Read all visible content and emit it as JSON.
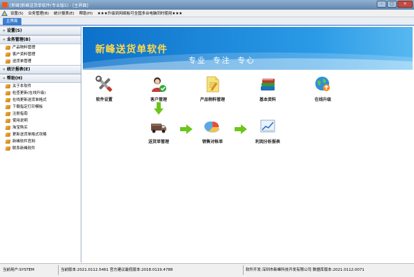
{
  "window": {
    "title": "[新峰]新峰送货单软件(专业版5) - [主界面]",
    "btn_min": "–",
    "btn_max": "□",
    "btn_close": "×"
  },
  "menubar": {
    "items": [
      "设置(S)",
      "业务管理(B)",
      "统计报表(E)",
      "帮助(H)",
      "★★★升级到网络板可全国多台电脑同时使用★★★"
    ]
  },
  "tab": {
    "label": "主界面"
  },
  "sidebar": {
    "sections": [
      {
        "title": "设置(S)",
        "chev": "»",
        "items": []
      },
      {
        "title": "业务管理(B)",
        "chev": "«",
        "items": [
          "产品物料管理",
          "客户资料管理",
          "送货单管理"
        ]
      },
      {
        "title": "统计报表(E)",
        "chev": "»",
        "items": []
      },
      {
        "title": "帮助(H)",
        "chev": "«",
        "items": [
          "关于本软件",
          "检查更新(在线升级)",
          "在线更新送货单格式",
          "下载指定打印模板",
          "注册指南",
          "使用说明",
          "淘宝购买",
          "更新送货单格式攻略",
          "新峰软件官网",
          "联系新峰软件"
        ]
      }
    ]
  },
  "banner": {
    "product_name": "新峰送货单软件",
    "slogan": "专业 专注 专心"
  },
  "modules": {
    "settings": "软件设置",
    "customers": "客户管理",
    "products": "产品物料管理",
    "basic_data": "基本资料",
    "online_upgrade": "在线升级",
    "delivery": "送货单管理",
    "sales_statement": "销售对帐单",
    "profit_report": "利润分析报表"
  },
  "statusbar": {
    "user": "当前用户:SYSTEM",
    "version": "当前版本:2021.0112.5461 官方建议最低版本:2018.0119.4788",
    "developer": "软件开发:深圳市新峰科技开发有限公司 数据库版本:2021.0112.0071"
  },
  "colors": {
    "banner_blue": "#1784d8",
    "tab_blue": "#3c7fd0",
    "arrow_green": "#6cc51b",
    "product_name": "#ffd84a"
  }
}
